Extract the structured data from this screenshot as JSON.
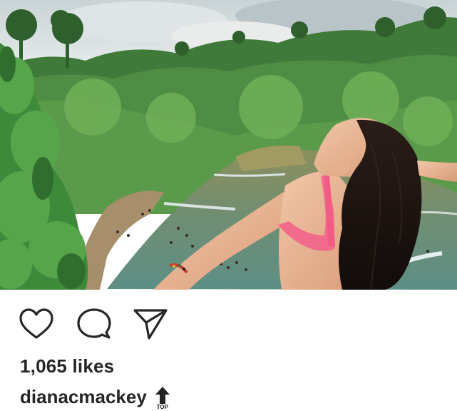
{
  "post": {
    "likes_text": "1,065 likes",
    "username": "dianacmackey",
    "emoji_label": "TOP"
  },
  "icons": {
    "like": "heart-icon",
    "comment": "comment-icon",
    "share": "send-icon",
    "emoji": "top-arrow-emoji-icon"
  },
  "colors": {
    "text": "#262626",
    "background": "#ffffff"
  }
}
